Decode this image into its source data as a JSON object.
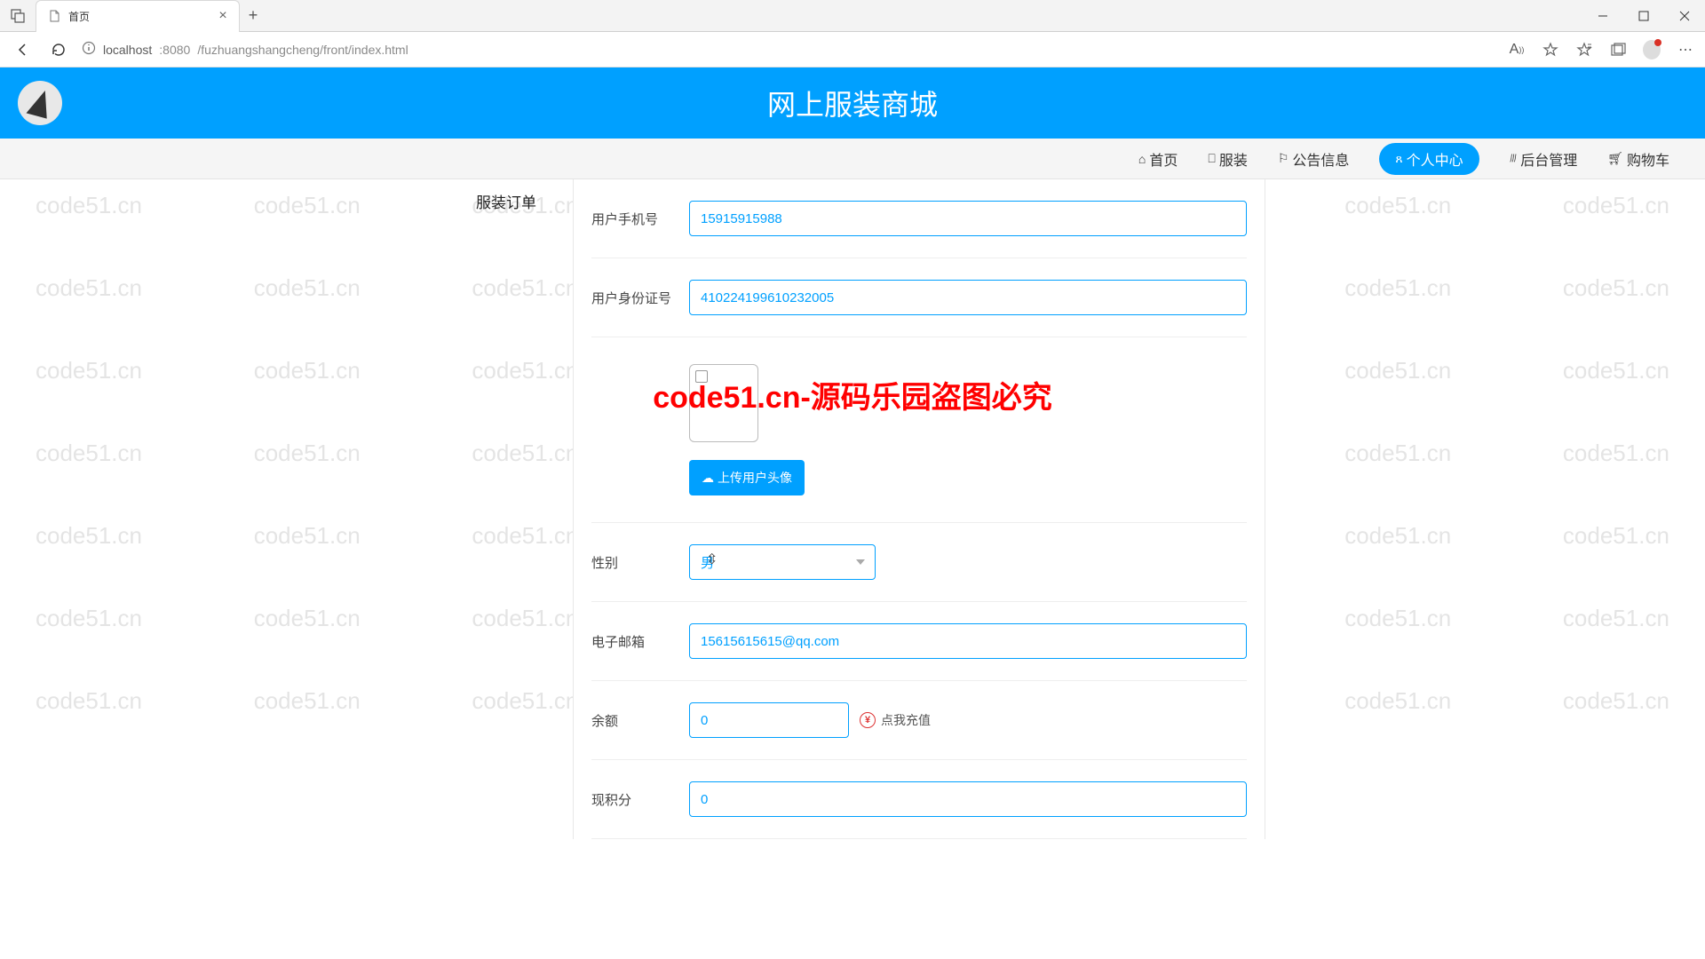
{
  "browser": {
    "tab_title": "首页",
    "url_host": "localhost",
    "url_port": ":8080",
    "url_path": "/fuzhuangshangcheng/front/index.html"
  },
  "banner": {
    "title": "网上服装商城"
  },
  "nav": {
    "home": "首页",
    "clothes": "服装",
    "notice": "公告信息",
    "profile": "个人中心",
    "admin": "后台管理",
    "cart": "购物车"
  },
  "sidebar": {
    "order": "服装订单"
  },
  "form": {
    "phone_label": "用户手机号",
    "phone_value": "15915915988",
    "idcard_label": "用户身份证号",
    "idcard_value": "410224199610232005",
    "upload_label": "上传用户头像",
    "gender_label": "性别",
    "gender_value": "男",
    "email_label": "电子邮箱",
    "email_value": "15615615615@qq.com",
    "balance_label": "余额",
    "balance_value": "0",
    "recharge_label": "点我充值",
    "points_label": "现积分",
    "points_value": "0"
  },
  "watermark": "code51.cn",
  "overlay": "code51.cn-源码乐园盗图必究"
}
